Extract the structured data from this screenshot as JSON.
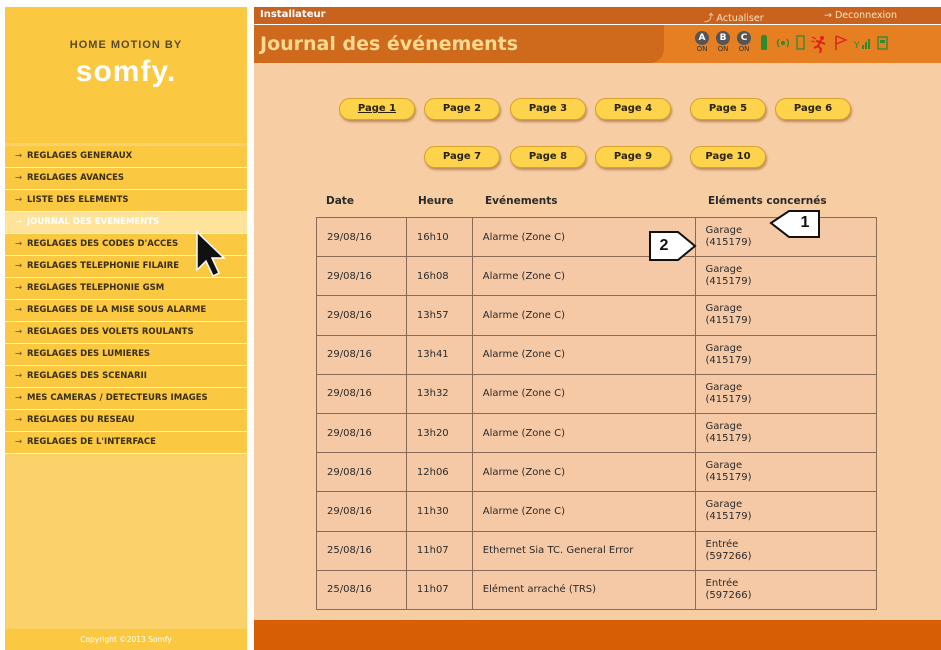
{
  "sidebar": {
    "brand_line1": "HOME MOTION BY",
    "brand_line2": "somfy.",
    "menu": [
      {
        "label": "REGLAGES GENERAUX"
      },
      {
        "label": "REGLAGES AVANCES"
      },
      {
        "label": "LISTE DES ELEMENTS"
      },
      {
        "label": "JOURNAL DES EVENEMENTS",
        "active": true
      },
      {
        "label": "REGLAGES DES CODES D'ACCES"
      },
      {
        "label": "REGLAGES TELEPHONIE FILAIRE"
      },
      {
        "label": "REGLAGES TELEPHONIE GSM"
      },
      {
        "label": "REGLAGES DE LA MISE SOUS ALARME"
      },
      {
        "label": "REGLAGES DES VOLETS ROULANTS"
      },
      {
        "label": "REGLAGES DES LUMIERES"
      },
      {
        "label": "REGLAGES DES SCENARII"
      },
      {
        "label": "MES CAMERAS / DETECTEURS IMAGES"
      },
      {
        "label": "REGLAGES DU RESEAU"
      },
      {
        "label": "REGLAGES DE L'INTERFACE"
      }
    ],
    "copyright": "Copyright ©2013 Somfy"
  },
  "header": {
    "role": "Installateur",
    "refresh": "Actualiser",
    "logout": "Deconnexion",
    "title": "Journal des événements",
    "zones": [
      {
        "letter": "A",
        "state": "ON"
      },
      {
        "letter": "B",
        "state": "ON"
      },
      {
        "letter": "C",
        "state": "ON"
      }
    ]
  },
  "pagination": {
    "row1": [
      "Page 1",
      "Page 2",
      "Page 3",
      "Page 4",
      "Page 5",
      "Page 6"
    ],
    "row2": [
      "Page 7",
      "Page 8",
      "Page 9",
      "Page 10"
    ],
    "current": "Page 1"
  },
  "table": {
    "columns": [
      "Date",
      "Heure",
      "Evénements",
      "Eléments concernés"
    ],
    "rows": [
      {
        "date": "29/08/16",
        "time": "16h10",
        "event": "Alarme (Zone C)",
        "element": "Garage",
        "code": "(415179)"
      },
      {
        "date": "29/08/16",
        "time": "16h08",
        "event": "Alarme (Zone C)",
        "element": "Garage",
        "code": "(415179)"
      },
      {
        "date": "29/08/16",
        "time": "13h57",
        "event": "Alarme (Zone C)",
        "element": "Garage",
        "code": "(415179)"
      },
      {
        "date": "29/08/16",
        "time": "13h41",
        "event": "Alarme (Zone C)",
        "element": "Garage",
        "code": "(415179)"
      },
      {
        "date": "29/08/16",
        "time": "13h32",
        "event": "Alarme (Zone C)",
        "element": "Garage",
        "code": "(415179)"
      },
      {
        "date": "29/08/16",
        "time": "13h20",
        "event": "Alarme (Zone C)",
        "element": "Garage",
        "code": "(415179)"
      },
      {
        "date": "29/08/16",
        "time": "12h06",
        "event": "Alarme (Zone C)",
        "element": "Garage",
        "code": "(415179)"
      },
      {
        "date": "29/08/16",
        "time": "11h30",
        "event": "Alarme (Zone C)",
        "element": "Garage",
        "code": "(415179)"
      },
      {
        "date": "25/08/16",
        "time": "11h07",
        "event": "Ethernet Sia TC. General Error",
        "element": "Entrée",
        "code": "(597266)"
      },
      {
        "date": "25/08/16",
        "time": "11h07",
        "event": "Elément arraché (TRS)",
        "element": "Entrée",
        "code": "(597266)"
      }
    ]
  },
  "callouts": [
    "1",
    "2"
  ],
  "colors": {
    "sidebar": "#fbc842",
    "header": "#c9621c",
    "title": "#fbd991",
    "content": "#f7cda4",
    "button": "#fcd34b",
    "footer": "#d85e06"
  }
}
